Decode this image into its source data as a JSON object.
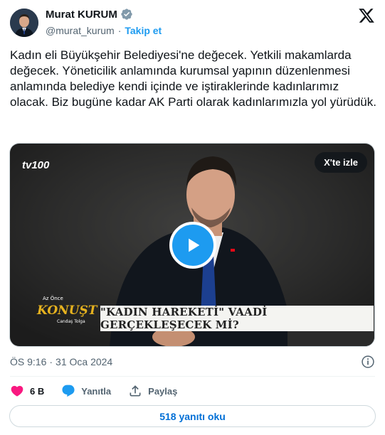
{
  "author": {
    "display_name": "Murat KURUM",
    "handle": "@murat_kurum",
    "follow_label": "Takip et",
    "verified_color": "#829aab"
  },
  "tweet": {
    "text": "Kadın eli Büyükşehir Belediyesi'ne değecek. Yetkili makamlarda değecek. Yöneticilik anlamında kurumsal yapının düzenlenmesi anlamında belediye kendi içinde ve iştiraklerinde kadınlarımız olacak. Biz bugüne kadar AK Parti olarak kadınlarımızla yol yürüdük."
  },
  "media": {
    "watch_label": "X'te izle",
    "channel_logo": "tv100",
    "show_logo_top": "Az Önce",
    "show_logo_main": "KONUŞTUM",
    "show_logo_sub": "Candaş Tolga",
    "banner_text": "\"KADIN HAREKETİ\" VAADİ GERÇEKLEŞECEK Mİ?",
    "play_color": "#1d9bf0"
  },
  "meta": {
    "time": "ÖS 9:16",
    "separator": "·",
    "date": "31 Oca 2024"
  },
  "actions": {
    "like_count": "6 B",
    "reply_label": "Yanıtla",
    "share_label": "Paylaş",
    "like_color": "#f91880",
    "reply_color": "#1d9bf0"
  },
  "replies_button": {
    "label": "518 yanıtı oku"
  },
  "icons": [
    "verified-badge-icon",
    "x-logo-icon",
    "play-icon",
    "info-icon",
    "heart-icon",
    "reply-icon",
    "share-icon"
  ]
}
